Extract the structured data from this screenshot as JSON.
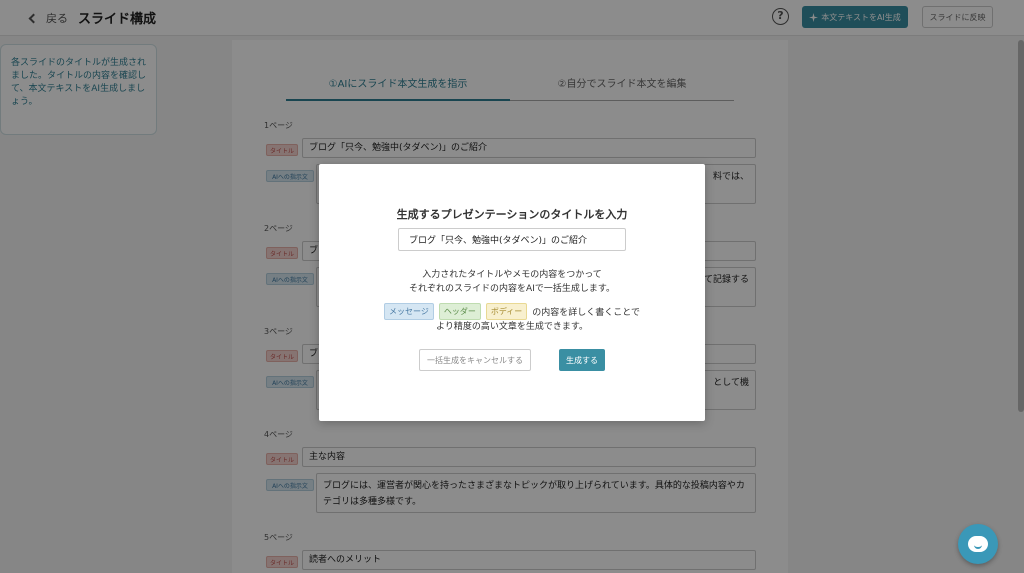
{
  "header": {
    "back_label": "戻る",
    "title": "スライド構成",
    "help_label": "?",
    "ai_button_label": "本文テキストをAI生成",
    "reflect_button_label": "スライドに反映"
  },
  "info_panel": {
    "text": "各スライドのタイトルが生成されました。タイトルの内容を確認して、本文テキストをAI生成しましょう。"
  },
  "tabs": [
    {
      "label": "①AIにスライド本文生成を指示"
    },
    {
      "label": "②自分でスライド本文を編集"
    }
  ],
  "tags": {
    "title": "タイトル",
    "ai": "AIへの指示文"
  },
  "pages": [
    {
      "label": "1ページ",
      "title": "ブログ「只今、勉強中(タダベン)」のご紹介",
      "ai_text": "料では、"
    },
    {
      "label": "2ページ",
      "title": "ブ",
      "ai_text": "て記録する"
    },
    {
      "label": "3ページ",
      "title": "ブ",
      "ai_text": "として機"
    },
    {
      "label": "4ページ",
      "title": "主な内容",
      "ai_text": "ブログには、運営者が関心を持ったさまざまなトピックが取り上げられています。具体的な投稿内容やカテゴリは多種多様です。"
    },
    {
      "label": "5ページ",
      "title": "読者へのメリット"
    }
  ],
  "modal": {
    "heading": "生成するプレゼンテーションのタイトルを入力",
    "input_value": "ブログ「只今、勉強中(タダベン)」のご紹介",
    "desc_line1": "入力されたタイトルやメモの内容をつかって",
    "desc_line2": "それぞれのスライドの内容をAIで一括生成します。",
    "tag_message": "メッセージ",
    "tag_header": "ヘッダー",
    "tag_body": "ボディー",
    "tags_suffix": "の内容を詳しく書くことで",
    "desc_line3": "より精度の高い文章を生成できます。",
    "cancel_label": "一括生成をキャンセルする",
    "generate_label": "生成する"
  },
  "colors": {
    "accent": "#3a8fa3",
    "info_text": "#2e7f93",
    "chat_button": "#3a98b8"
  },
  "icons": {
    "back": "chevron-left-icon",
    "help": "question-circle-icon",
    "ai": "sparkle-icon",
    "chat": "chat-bubble-icon"
  }
}
